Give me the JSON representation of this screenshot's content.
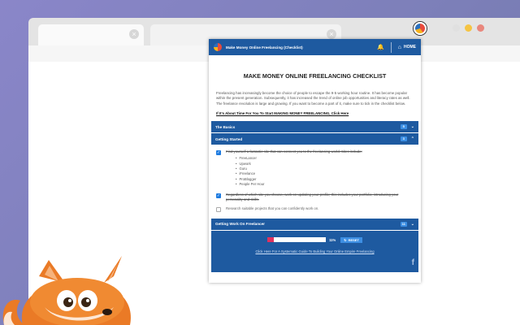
{
  "colors": {
    "primary": "#1e5aa0",
    "accent": "#3d8fe3",
    "progress": "#e0325f"
  },
  "browser": {
    "tabs": [
      {
        "close": "×"
      },
      {
        "close": "×"
      }
    ],
    "window_dots": [
      "#e0e0e0",
      "#f5c443",
      "#e9877d"
    ]
  },
  "popup": {
    "header_title": "Make Money Online Freelancing (Checklist)",
    "bell_icon": "🔔",
    "home_icon": "⌂",
    "home_label": "HOME",
    "heading": "MAKE MONEY ONLINE FREELANCING CHECKLIST",
    "intro": "Freelancing has increasingly become the choice of people to escape the 9-5 working hour routine. It has become popular within the present generation. Subsequently, it has increased the trend of online job opportunities and literacy rates as well. The freelance revolution is large and growing. If you want to become a part of it, make sure to tick in the checklist below.",
    "cta": "If It's About Time For You To Start MAKING MONEY FREELANCING, Click Here",
    "sections": [
      {
        "label": "The Basics",
        "count": "5",
        "chev": "⌄"
      },
      {
        "label": "Getting Started",
        "count": "3",
        "chev": "⌃"
      },
      {
        "label": "Getting Work On Freelancer",
        "count": "11",
        "chev": "⌄"
      }
    ],
    "items": [
      {
        "text": "Find yourself a fantastic site that can connect you to the freelancing world. Sites include:",
        "sub": [
          "FreeLancer",
          "Upwork",
          "Guru",
          "iFreelance",
          "ProBlogger",
          "People Per Hour"
        ]
      },
      {
        "text": "Regardless of which site you choose, work on updating your profile; this includes your portfolio, introducing your personality and skills."
      },
      {
        "text": "Research suitable projects that you can confidently work on."
      }
    ],
    "checkmark": "✓",
    "progress_percent": 11,
    "progress_label": "11%",
    "reset_icon": "↻",
    "reset_label": "RESET",
    "guide_link": "Click Here For A Systematic Guide To Building Your Online Empire Freelancing",
    "fb_icon": "f"
  }
}
